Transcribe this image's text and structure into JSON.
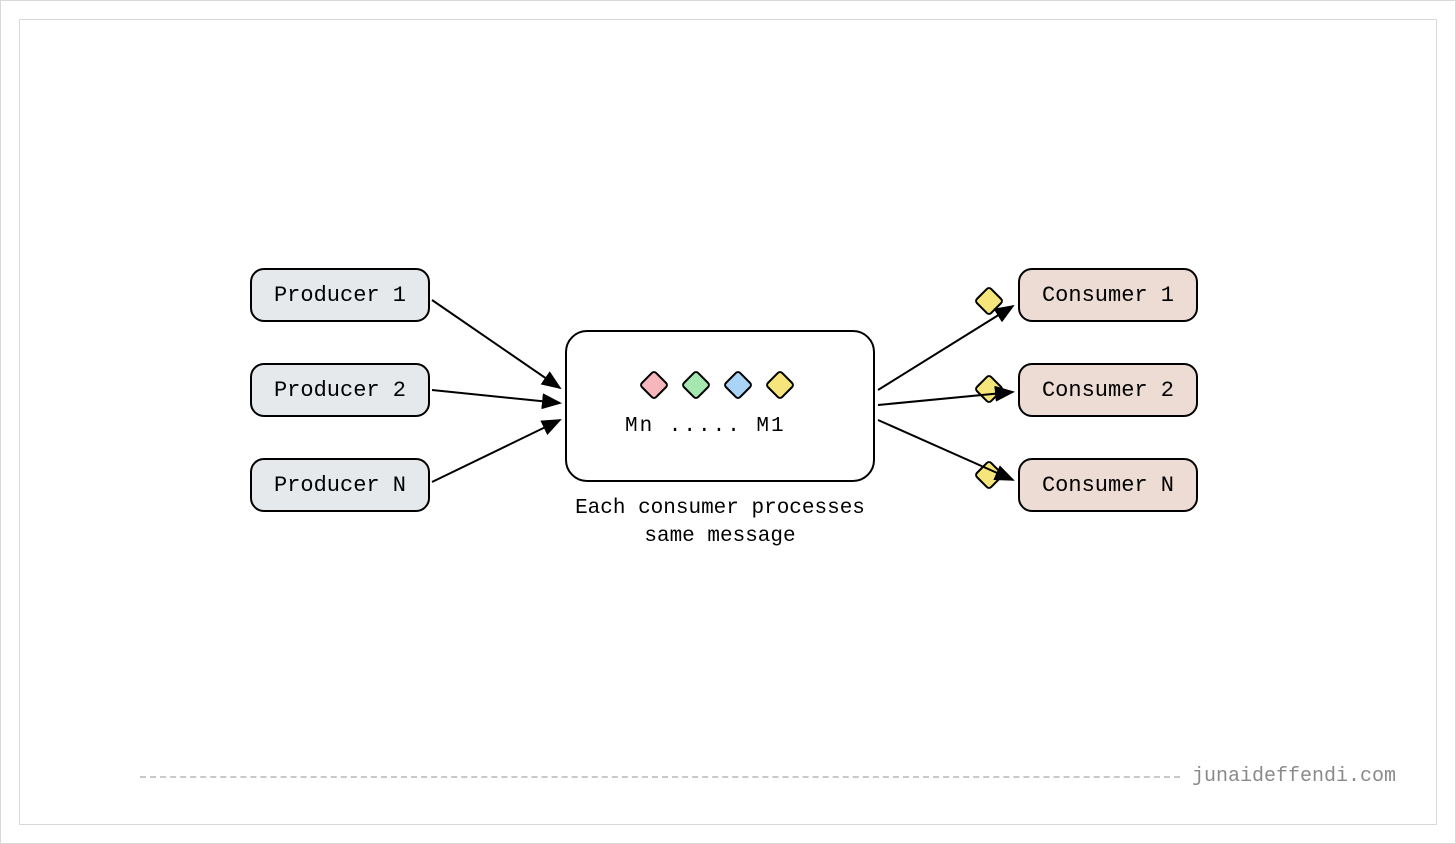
{
  "producers": [
    {
      "label": "Producer 1"
    },
    {
      "label": "Producer 2"
    },
    {
      "label": "Producer N"
    }
  ],
  "consumers": [
    {
      "label": "Consumer 1"
    },
    {
      "label": "Consumer 2"
    },
    {
      "label": "Consumer N"
    }
  ],
  "queue": {
    "label_row": "Mn ..... M1",
    "caption_line1": "Each consumer processes",
    "caption_line2": "same message",
    "messages": [
      {
        "color": "#f6b6bb"
      },
      {
        "color": "#a6e6b1"
      },
      {
        "color": "#a9d4f7"
      },
      {
        "color": "#f6e57a"
      }
    ]
  },
  "consumer_message_color": "#f6e57a",
  "footer_domain": "junaideffendi.com"
}
